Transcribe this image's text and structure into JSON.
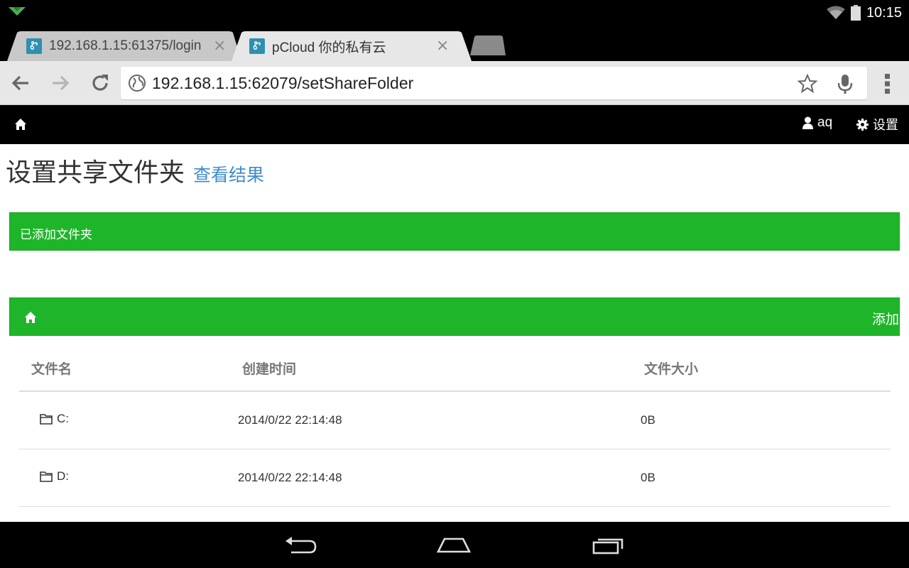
{
  "status_bar": {
    "time": "10:15",
    "icons": [
      "notification-icon",
      "wifi-icon",
      "battery-icon"
    ]
  },
  "tabs": [
    {
      "title": "192.168.1.15:61375/login",
      "favicon": "Ꮡ",
      "active": false
    },
    {
      "title": "pCloud 你的私有云",
      "favicon": "Ꮡ",
      "active": true
    }
  ],
  "tab_close_glyph": "×",
  "toolbar": {
    "url": "192.168.1.15:62079/setShareFolder"
  },
  "navbar": {
    "user_label": "aq",
    "settings_label": "设置"
  },
  "page": {
    "title": "设置共享文件夹",
    "view_results_link": "查看结果",
    "alert_message": "已添加文件夹",
    "add_button": "添加"
  },
  "table": {
    "headers": [
      "文件名",
      "创建时间",
      "文件大小"
    ],
    "rows": [
      {
        "name": "C:",
        "created": "2014/0/22 22:14:48",
        "size": "0B"
      },
      {
        "name": "D:",
        "created": "2014/0/22 22:14:48",
        "size": "0B"
      }
    ]
  },
  "colors": {
    "success_green": "#1fb52a",
    "link_blue": "#428bca",
    "navbar_black": "#000000"
  }
}
